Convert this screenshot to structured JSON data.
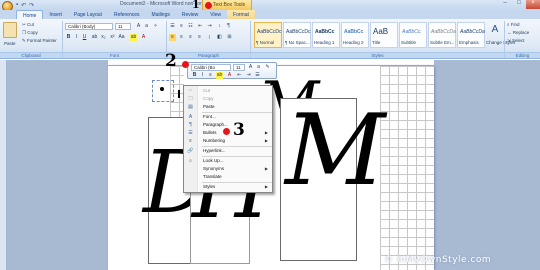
{
  "titlebar": {
    "window_title": "Document2 - Microsoft Word non-commercial use",
    "context_tab": "Text Box Tools",
    "minimize": "–",
    "maximize": "□",
    "close": "×"
  },
  "tabs": [
    "Home",
    "Insert",
    "Page Layout",
    "References",
    "Mailings",
    "Review",
    "View",
    "Format"
  ],
  "ribbon": {
    "clipboard": {
      "paste": "Paste",
      "cut": "Cut",
      "copy": "Copy",
      "format_painter": "Format Painter",
      "label": "Clipboard"
    },
    "font": {
      "family": "Calibri (Body)",
      "size": "11",
      "bold": "B",
      "italic": "I",
      "underline": "U",
      "label": "Font"
    },
    "paragraph": {
      "label": "Paragraph"
    },
    "styles": {
      "label": "Styles",
      "items": [
        {
          "sample": "AaBbCcDc",
          "name": "¶ Normal"
        },
        {
          "sample": "AaBbCcDc",
          "name": "¶ No Spac..."
        },
        {
          "sample": "AaBbCc",
          "name": "Heading 1"
        },
        {
          "sample": "AaBbCc",
          "name": "Heading 2"
        },
        {
          "sample": "AaB",
          "name": "Title"
        },
        {
          "sample": "AaBbCc.",
          "name": "Subtitle"
        },
        {
          "sample": "AaBbCcDa",
          "name": "Subtle Em..."
        },
        {
          "sample": "AaBbCcDa",
          "name": "Emphasis"
        }
      ],
      "change_styles": "Change Styles"
    },
    "editing": {
      "find": "Find",
      "replace": "Replace",
      "select": "Select",
      "label": "Editing"
    }
  },
  "mini_toolbar": {
    "font": "Calibri (Bo",
    "size": "11"
  },
  "context_menu": {
    "items": [
      {
        "icon": "cut-icon",
        "label": "Cut",
        "enabled": false
      },
      {
        "icon": "copy-icon",
        "label": "Copy",
        "enabled": false
      },
      {
        "icon": "paste-icon",
        "label": "Paste",
        "enabled": true
      },
      {
        "icon": "font-icon",
        "label": "Font...",
        "enabled": true
      },
      {
        "icon": "paragraph-icon",
        "label": "Paragraph...",
        "enabled": true
      },
      {
        "icon": "bullets-icon",
        "label": "Bullets",
        "enabled": true,
        "submenu": true
      },
      {
        "icon": "numbering-icon",
        "label": "Numbering",
        "enabled": true,
        "submenu": true
      },
      {
        "icon": "hyperlink-icon",
        "label": "Hyperlink...",
        "enabled": true
      },
      {
        "icon": "lookup-icon",
        "label": "Look Up...",
        "enabled": true
      },
      {
        "icon": "synonyms-icon",
        "label": "Synonyms",
        "enabled": true,
        "submenu": true
      },
      {
        "icon": "translate-icon",
        "label": "Translate",
        "enabled": true
      },
      {
        "icon": "styles-icon",
        "label": "Styles",
        "enabled": true,
        "submenu": true
      }
    ]
  },
  "document": {
    "monogram_left": "D",
    "monogram_mid": "H",
    "monogram_right": "M",
    "monogram_top": "M"
  },
  "annotations": [
    "1",
    "2",
    "3"
  ],
  "watermark": "© InMyOwnStyle.com",
  "colors": {
    "annotation_dot": "#e8141c",
    "ribbon_bg": "#dfe9f5",
    "context_tab": "#f5c95d"
  }
}
